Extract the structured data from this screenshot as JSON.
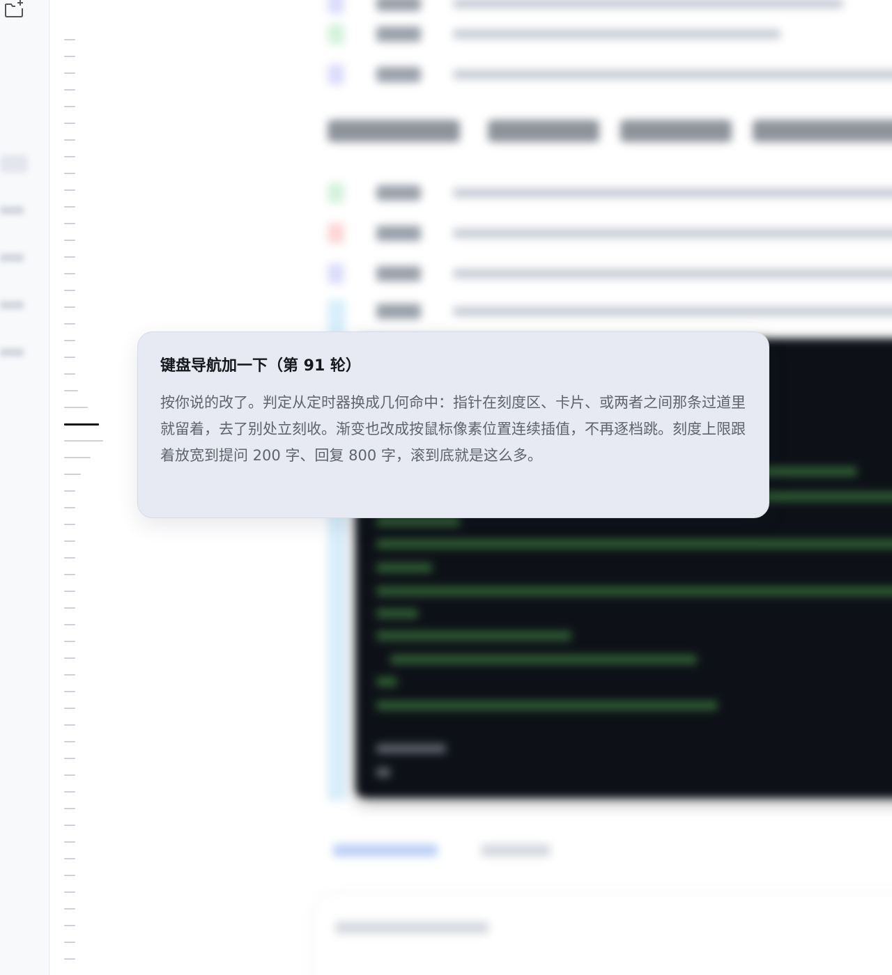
{
  "sidebar": {
    "new_chat_icon": "new-chat-icon"
  },
  "tooltip": {
    "title": "键盘导航加一下（第 91 轮）",
    "body": "按你说的改了。判定从定时器换成几何命中：指针在刻度区、卡片、或两者之间那条过道里就留着，去了别处立刻收。渐变也改成按鼠标像素位置连续插值，不再逐档跳。刻度上限跟着放宽到提问 200 字、回复 800 字，滚到底就是这么多。"
  },
  "tick_rail": {
    "active_index": 23
  },
  "colors": {
    "tooltip_bg": "#e7eaf2",
    "code_bg": "#0d1117",
    "active_tick": "#111111",
    "inactive_tick": "#cfd2d8"
  }
}
